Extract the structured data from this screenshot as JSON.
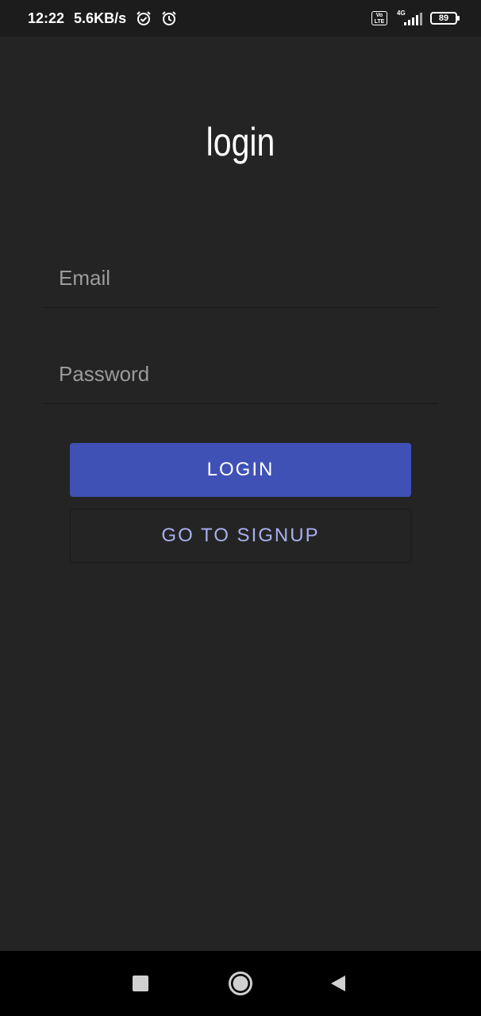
{
  "status_bar": {
    "time": "12:22",
    "network_speed": "5.6KB/s",
    "volte_label": "Vo\nLTE",
    "network_type": "4G",
    "battery_level": "89",
    "icons": [
      "alarm-set-icon",
      "alarm-icon",
      "volte-icon",
      "signal-icon",
      "battery-icon"
    ]
  },
  "login_screen": {
    "title": "login",
    "email_placeholder": "Email",
    "email_value": "",
    "password_placeholder": "Password",
    "password_value": "",
    "login_button": "LOGIN",
    "signup_button": "GO TO SIGNUP"
  },
  "navigation_bar": {
    "icons": [
      "recents-square-icon",
      "home-circle-icon",
      "back-triangle-icon"
    ]
  },
  "colors": {
    "background": "#242424",
    "status_bar": "#1c1c1c",
    "primary_button": "#3f51b5",
    "secondary_button_text": "#a9b0ee",
    "placeholder": "#9b9b9b",
    "nav_bar": "#000000"
  }
}
